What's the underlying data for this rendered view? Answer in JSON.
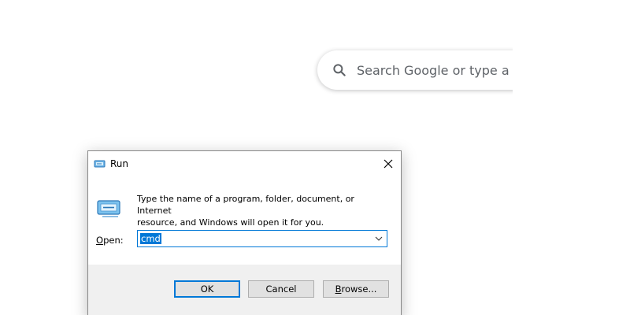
{
  "browser": {
    "search_placeholder": "Search Google or type a UR"
  },
  "run_dialog": {
    "title": "Run",
    "description_line1": "Type the name of a program, folder, document, or Internet",
    "description_line2": "resource, and Windows will open it for you.",
    "open_label_accel": "O",
    "open_label_rest": "pen:",
    "open_value": "cmd",
    "buttons": {
      "ok": "OK",
      "cancel": "Cancel",
      "browse_accel": "B",
      "browse_rest": "rowse..."
    }
  },
  "colors": {
    "accent": "#0078d7",
    "footer_bg": "#f0f0f0",
    "button_bg": "#e1e1e1"
  }
}
